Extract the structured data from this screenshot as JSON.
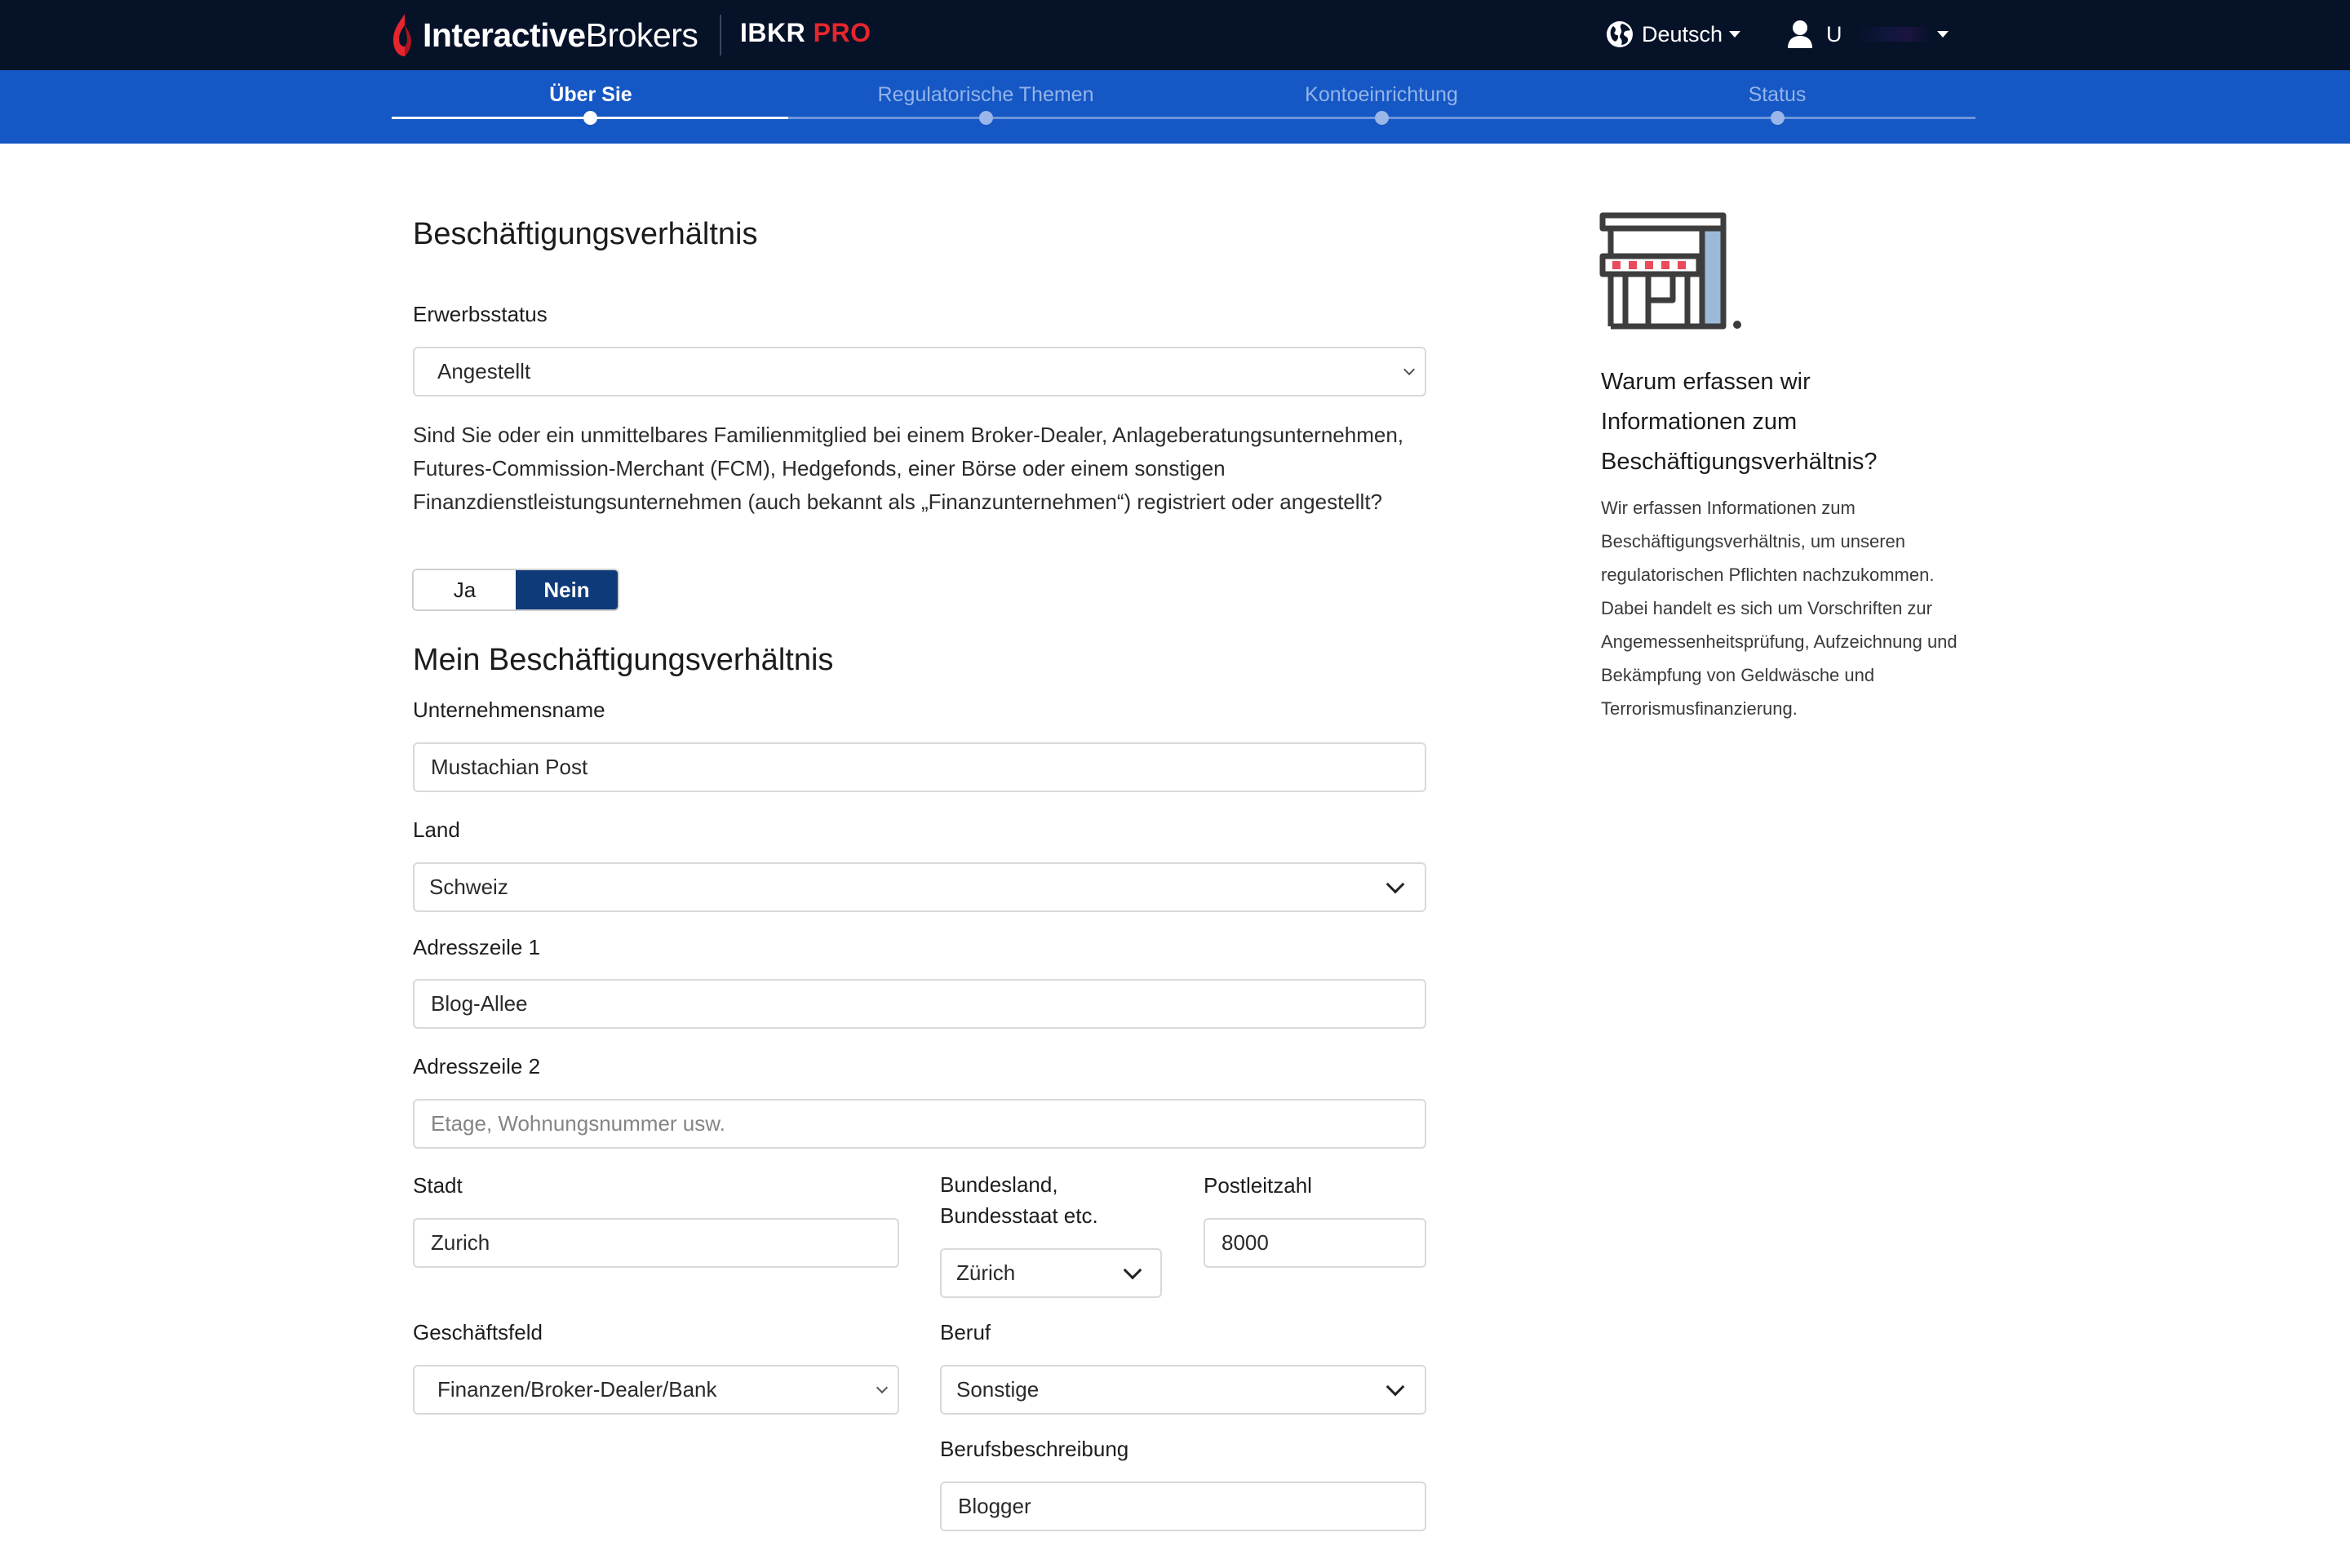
{
  "header": {
    "logo_bold": "Interactive",
    "logo_light": "Brokers",
    "product": "IBKR",
    "product_accent": "PRO",
    "language": "Deutsch",
    "user_initial": "U",
    "icons": {
      "language": "globe-icon",
      "user": "user-icon"
    }
  },
  "steps": [
    {
      "label": "Über Sie",
      "active": true
    },
    {
      "label": "Regulatorische Themen",
      "active": false
    },
    {
      "label": "Kontoeinrichtung",
      "active": false
    },
    {
      "label": "Status",
      "active": false
    }
  ],
  "employment": {
    "title": "Beschäftigungsverhältnis",
    "status_label": "Erwerbsstatus",
    "status_value": "Angestellt",
    "question": "Sind Sie oder ein unmittelbares Familienmitglied bei einem Broker-Dealer, Anlageberatungsunternehmen, Futures-Commission-Merchant (FCM), Hedgefonds, einer Börse oder einem sonstigen Finanzdienstleistungsunternehmen (auch bekannt als „Finanzunternehmen“) registriert oder angestellt?",
    "answer_yes": "Ja",
    "answer_no": "Nein",
    "selected_answer": "Nein"
  },
  "my_employment": {
    "title": "Mein Beschäftigungsverhältnis",
    "company_label": "Unternehmensname",
    "company_value": "Mustachian Post",
    "country_label": "Land",
    "country_value": "Schweiz",
    "address1_label": "Adresszeile 1",
    "address1_value": "Blog-Allee",
    "address2_label": "Adresszeile 2",
    "address2_placeholder": "Etage, Wohnungsnummer usw.",
    "city_label": "Stadt",
    "city_value": "Zurich",
    "state_label_line1": "Bundesland,",
    "state_label_line2": "Bundesstaat etc.",
    "state_value": "Zürich",
    "zip_label": "Postleitzahl",
    "zip_value": "8000",
    "business_label": "Geschäftsfeld",
    "business_value": "Finanzen/Broker-Dealer/Bank",
    "occupation_label": "Beruf",
    "occupation_value": "Sonstige",
    "occupation_desc_label": "Berufsbeschreibung",
    "occupation_desc_value": "Blogger"
  },
  "side_panel": {
    "icon": "storefront-icon",
    "title": "Warum erfassen wir Informationen zum Beschäftigungsverhältnis?",
    "text": "Wir erfassen Informationen zum Beschäftigungsverhältnis, um unseren regulatorischen Pflichten nachzukommen. Dabei handelt es sich um Vorschriften zur Angemessenheitsprüfung, Aufzeichnung und Bekämpfung von Geldwäsche und Terrorismusfinanzierung."
  },
  "colors": {
    "topbar": "#061228",
    "stepsbar": "#1557c4",
    "accent_red": "#e5262e",
    "toggle_selected": "#0f3a79"
  }
}
